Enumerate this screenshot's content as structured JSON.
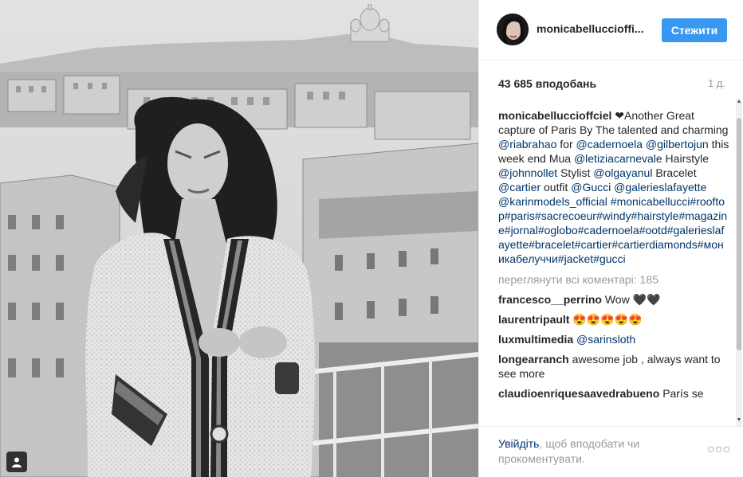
{
  "post": {
    "username": "monicabelluccioffi...",
    "follow_label": "Стежити",
    "likes": "43 685 вподобань",
    "time": "1 д."
  },
  "caption": {
    "user": "monicabelluccioffciel",
    "heart": "❤",
    "t1": "Another Great capture of Paris By The talented and charming ",
    "m1": "@riabrahao",
    "t2": " for ",
    "m2": "@cadernoela",
    "m3": "@gilbertojun",
    "t3": " this week end Mua ",
    "m4": "@letiziacarnevale",
    "t4": " Hairstyle ",
    "m5": "@johnnollet",
    "t5": " Stylist ",
    "m6": "@olgayanul",
    "t6": " Bracelet ",
    "m7": "@cartier",
    "t7": " outfit ",
    "m8": "@Gucci",
    "m9": "@galerieslafayette",
    "m10": "@karinmodels_official",
    "tags": "#monicabellucci#rooftop#paris#sacrecoeur#windy#hairstyle#magazine#jornal#oglobo#cadernoela#ootd#galerieslafayette#bracelet#cartier#cartierdiamonds#моникабелуччи#jacket#gucci"
  },
  "view_all": "переглянути всі коментарі: 185",
  "comments": [
    {
      "user": "francesco__perrino",
      "text": "Wow 🖤🖤"
    },
    {
      "user": "laurentripault",
      "text": "😍😍😍😍😍"
    },
    {
      "user": "luxmultimedia",
      "text": "@sarinsloth"
    },
    {
      "user": "longearranch",
      "text": "awesome job , always want to see more"
    },
    {
      "user": "claudioenriquesaavedrabueno",
      "text": "París se"
    }
  ],
  "footer": {
    "login_link": "Увійдіть",
    "login_rest": ", щоб вподобати чи прокоментувати.",
    "more": "○○○"
  }
}
